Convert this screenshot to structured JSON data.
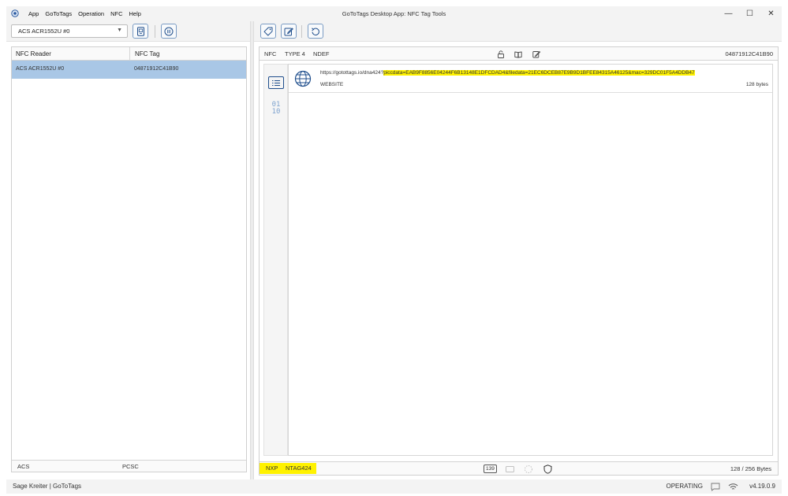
{
  "window": {
    "title": "GoToTags Desktop App: NFC Tag Tools",
    "menu": [
      "App",
      "GoToTags",
      "Operation",
      "NFC",
      "Help"
    ],
    "controls": {
      "minimize": "—",
      "maximize": "☐",
      "close": "✕"
    }
  },
  "left_toolbar": {
    "reader_selected": "ACS ACR1552U #0"
  },
  "reader_table": {
    "headers": {
      "reader": "NFC Reader",
      "tag": "NFC Tag"
    },
    "rows": [
      {
        "reader": "ACS ACR1552U #0",
        "tag": "04871912C41B90",
        "selected": true
      }
    ],
    "footer": {
      "vendor": "ACS",
      "interface": "PCSC"
    }
  },
  "tag_panel": {
    "header": {
      "tech": "NFC",
      "type": "TYPE 4",
      "format": "NDEF",
      "uid": "04871912C41B90"
    },
    "record": {
      "url_prefix": "https://gotottags.io/dna424?",
      "url_highlight": "piccdata=EAB9F8856E04244F6B13148E1DFCDAD4&filedata=21EC6DCEB87E9B9D1BFEE84315A46125&mac=329DC01F5A4DDB47",
      "kind": "WEBSITE",
      "size": "128 bytes"
    },
    "sidebar_binary_label": {
      "line1": "01",
      "line2": "10"
    },
    "footer": {
      "manufacturer": "NXP",
      "chip": "NTAG424",
      "badge": "139",
      "capacity": "128 / 256 Bytes"
    }
  },
  "statusbar": {
    "user": "Sage Kreiter | GoToTags",
    "state": "OPERATING",
    "version": "v4.19.0.9"
  },
  "colors": {
    "selection": "#a9c7e6",
    "highlight": "#fff200",
    "accent": "#1f4e8c"
  }
}
